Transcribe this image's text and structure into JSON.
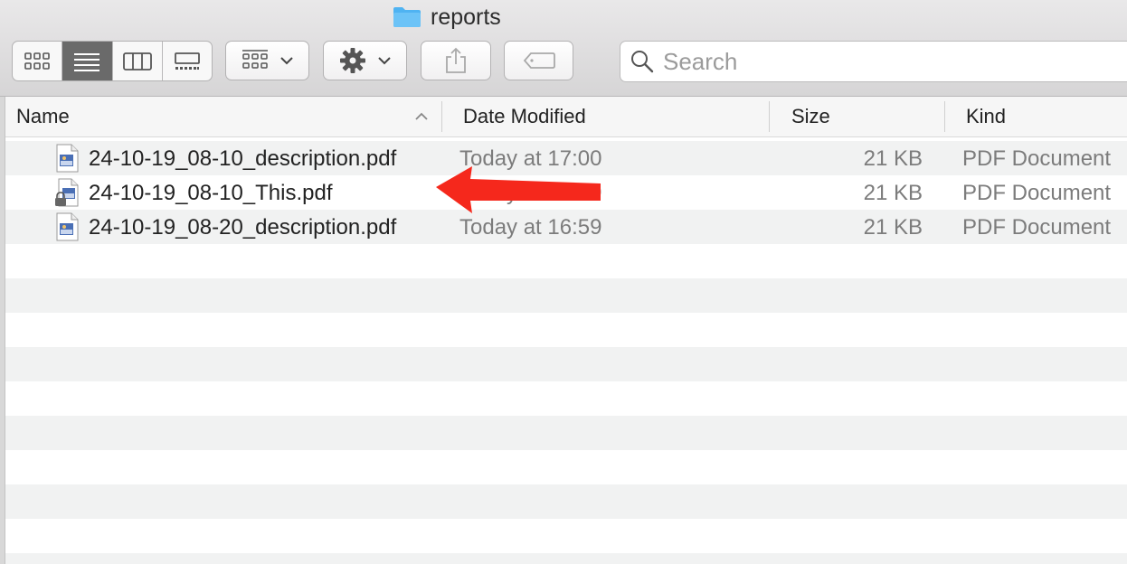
{
  "window": {
    "title": "reports"
  },
  "toolbar": {
    "view_modes": [
      "icon-view",
      "list-view",
      "column-view",
      "gallery-view"
    ],
    "active_view": "list-view",
    "group_icon": "group-grid-icon",
    "action_icon": "gear-icon",
    "share_icon": "share-icon",
    "tag_icon": "tag-icon"
  },
  "search": {
    "placeholder": "Search",
    "value": ""
  },
  "columns": {
    "name": "Name",
    "date": "Date Modified",
    "size": "Size",
    "kind": "Kind"
  },
  "files": [
    {
      "name": "24-10-19_08-10_description.pdf",
      "date": "Today at 17:00",
      "size": "21 KB",
      "kind": "PDF Document",
      "locked": false
    },
    {
      "name": "24-10-19_08-10_This.pdf",
      "date": "Today at 16:59",
      "size": "21 KB",
      "kind": "PDF Document",
      "locked": true
    },
    {
      "name": "24-10-19_08-20_description.pdf",
      "date": "Today at 16:59",
      "size": "21 KB",
      "kind": "PDF Document",
      "locked": false
    }
  ],
  "annotation": {
    "type": "arrow",
    "color": "#f5281c"
  }
}
